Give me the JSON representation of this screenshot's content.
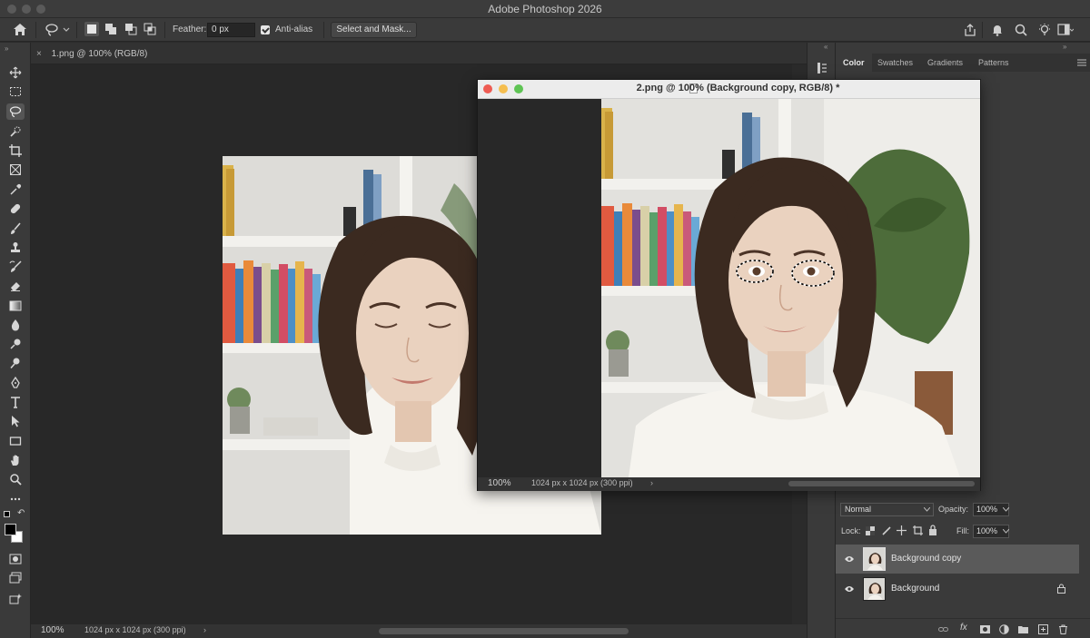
{
  "app": {
    "title": "Adobe Photoshop 2026"
  },
  "options": {
    "feather_label": "Feather:",
    "feather_value": "0 px",
    "antialias_label": "Anti-alias",
    "antialias_checked": true,
    "select_mask_label": "Select and Mask..."
  },
  "documents": {
    "back": {
      "tab_label": "1.png @ 100% (RGB/8)",
      "zoom": "100%",
      "size": "1024 px x 1024 px (300 ppi)",
      "arrow": "›"
    },
    "front": {
      "title": "2.png @ 100% (Background copy, RGB/8) *",
      "zoom": "100%",
      "size": "1024 px x 1024 px (300 ppi)",
      "arrow": "›"
    }
  },
  "panels": {
    "tabs": [
      "Color",
      "Swatches",
      "Gradients",
      "Patterns"
    ],
    "active_tab": "Color"
  },
  "layers": {
    "blend_mode": "Normal",
    "opacity_label": "Opacity:",
    "opacity_value": "100%",
    "lock_label": "Lock:",
    "fill_label": "Fill:",
    "fill_value": "100%",
    "items": [
      {
        "name": "Background copy",
        "selected": true,
        "locked": false
      },
      {
        "name": "Background",
        "selected": false,
        "locked": true
      }
    ]
  },
  "colors": {
    "accent_close": "#ee5b52",
    "accent_min": "#f5be4f",
    "accent_max": "#5fc454"
  }
}
